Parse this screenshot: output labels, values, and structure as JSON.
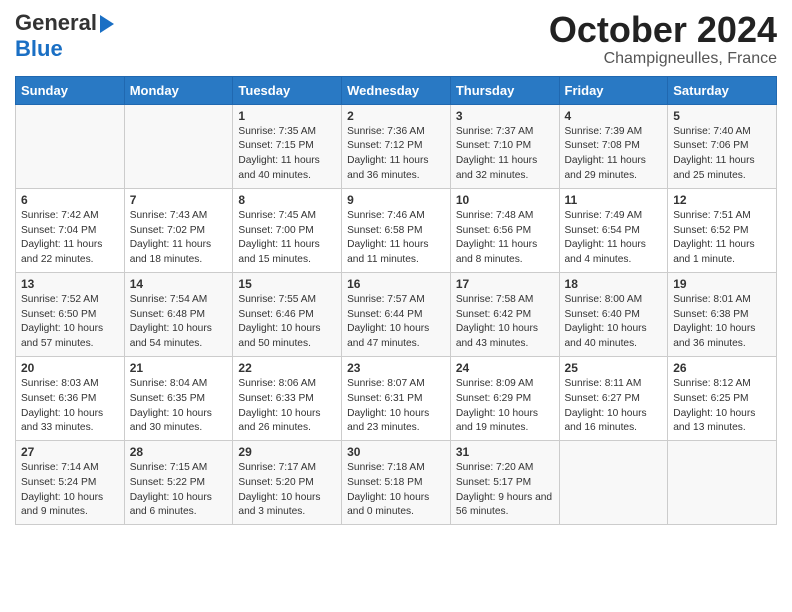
{
  "header": {
    "logo_general": "General",
    "logo_blue": "Blue",
    "month_title": "October 2024",
    "location": "Champigneulles, France"
  },
  "days_of_week": [
    "Sunday",
    "Monday",
    "Tuesday",
    "Wednesday",
    "Thursday",
    "Friday",
    "Saturday"
  ],
  "weeks": [
    [
      {
        "day": "",
        "content": ""
      },
      {
        "day": "",
        "content": ""
      },
      {
        "day": "1",
        "content": "Sunrise: 7:35 AM\nSunset: 7:15 PM\nDaylight: 11 hours and 40 minutes."
      },
      {
        "day": "2",
        "content": "Sunrise: 7:36 AM\nSunset: 7:12 PM\nDaylight: 11 hours and 36 minutes."
      },
      {
        "day": "3",
        "content": "Sunrise: 7:37 AM\nSunset: 7:10 PM\nDaylight: 11 hours and 32 minutes."
      },
      {
        "day": "4",
        "content": "Sunrise: 7:39 AM\nSunset: 7:08 PM\nDaylight: 11 hours and 29 minutes."
      },
      {
        "day": "5",
        "content": "Sunrise: 7:40 AM\nSunset: 7:06 PM\nDaylight: 11 hours and 25 minutes."
      }
    ],
    [
      {
        "day": "6",
        "content": "Sunrise: 7:42 AM\nSunset: 7:04 PM\nDaylight: 11 hours and 22 minutes."
      },
      {
        "day": "7",
        "content": "Sunrise: 7:43 AM\nSunset: 7:02 PM\nDaylight: 11 hours and 18 minutes."
      },
      {
        "day": "8",
        "content": "Sunrise: 7:45 AM\nSunset: 7:00 PM\nDaylight: 11 hours and 15 minutes."
      },
      {
        "day": "9",
        "content": "Sunrise: 7:46 AM\nSunset: 6:58 PM\nDaylight: 11 hours and 11 minutes."
      },
      {
        "day": "10",
        "content": "Sunrise: 7:48 AM\nSunset: 6:56 PM\nDaylight: 11 hours and 8 minutes."
      },
      {
        "day": "11",
        "content": "Sunrise: 7:49 AM\nSunset: 6:54 PM\nDaylight: 11 hours and 4 minutes."
      },
      {
        "day": "12",
        "content": "Sunrise: 7:51 AM\nSunset: 6:52 PM\nDaylight: 11 hours and 1 minute."
      }
    ],
    [
      {
        "day": "13",
        "content": "Sunrise: 7:52 AM\nSunset: 6:50 PM\nDaylight: 10 hours and 57 minutes."
      },
      {
        "day": "14",
        "content": "Sunrise: 7:54 AM\nSunset: 6:48 PM\nDaylight: 10 hours and 54 minutes."
      },
      {
        "day": "15",
        "content": "Sunrise: 7:55 AM\nSunset: 6:46 PM\nDaylight: 10 hours and 50 minutes."
      },
      {
        "day": "16",
        "content": "Sunrise: 7:57 AM\nSunset: 6:44 PM\nDaylight: 10 hours and 47 minutes."
      },
      {
        "day": "17",
        "content": "Sunrise: 7:58 AM\nSunset: 6:42 PM\nDaylight: 10 hours and 43 minutes."
      },
      {
        "day": "18",
        "content": "Sunrise: 8:00 AM\nSunset: 6:40 PM\nDaylight: 10 hours and 40 minutes."
      },
      {
        "day": "19",
        "content": "Sunrise: 8:01 AM\nSunset: 6:38 PM\nDaylight: 10 hours and 36 minutes."
      }
    ],
    [
      {
        "day": "20",
        "content": "Sunrise: 8:03 AM\nSunset: 6:36 PM\nDaylight: 10 hours and 33 minutes."
      },
      {
        "day": "21",
        "content": "Sunrise: 8:04 AM\nSunset: 6:35 PM\nDaylight: 10 hours and 30 minutes."
      },
      {
        "day": "22",
        "content": "Sunrise: 8:06 AM\nSunset: 6:33 PM\nDaylight: 10 hours and 26 minutes."
      },
      {
        "day": "23",
        "content": "Sunrise: 8:07 AM\nSunset: 6:31 PM\nDaylight: 10 hours and 23 minutes."
      },
      {
        "day": "24",
        "content": "Sunrise: 8:09 AM\nSunset: 6:29 PM\nDaylight: 10 hours and 19 minutes."
      },
      {
        "day": "25",
        "content": "Sunrise: 8:11 AM\nSunset: 6:27 PM\nDaylight: 10 hours and 16 minutes."
      },
      {
        "day": "26",
        "content": "Sunrise: 8:12 AM\nSunset: 6:25 PM\nDaylight: 10 hours and 13 minutes."
      }
    ],
    [
      {
        "day": "27",
        "content": "Sunrise: 7:14 AM\nSunset: 5:24 PM\nDaylight: 10 hours and 9 minutes."
      },
      {
        "day": "28",
        "content": "Sunrise: 7:15 AM\nSunset: 5:22 PM\nDaylight: 10 hours and 6 minutes."
      },
      {
        "day": "29",
        "content": "Sunrise: 7:17 AM\nSunset: 5:20 PM\nDaylight: 10 hours and 3 minutes."
      },
      {
        "day": "30",
        "content": "Sunrise: 7:18 AM\nSunset: 5:18 PM\nDaylight: 10 hours and 0 minutes."
      },
      {
        "day": "31",
        "content": "Sunrise: 7:20 AM\nSunset: 5:17 PM\nDaylight: 9 hours and 56 minutes."
      },
      {
        "day": "",
        "content": ""
      },
      {
        "day": "",
        "content": ""
      }
    ]
  ]
}
